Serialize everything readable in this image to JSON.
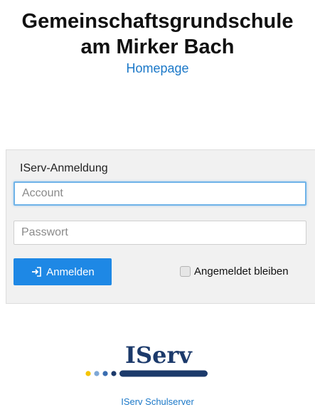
{
  "header": {
    "title_line1": "Gemeinschaftsgrundschule",
    "title_line2": "am Mirker Bach",
    "homepage_link": "Homepage"
  },
  "login": {
    "heading": "IServ-Anmeldung",
    "account_placeholder": "Account",
    "account_value": "",
    "password_placeholder": "Passwort",
    "password_value": "",
    "submit_label": "Anmelden",
    "submit_icon": "sign-in-icon",
    "remember_label": "Angemeldet bleiben",
    "remember_checked": false
  },
  "footer": {
    "logo_text": "IServ",
    "server_label": "IServ Schulserver"
  },
  "colors": {
    "accent": "#1e88e5",
    "link": "#1b78c8",
    "logo_navy": "#1c3a6b",
    "logo_yellow": "#f5c400",
    "logo_blue_light": "#7fa8d6",
    "logo_blue_mid": "#3a6db0"
  }
}
